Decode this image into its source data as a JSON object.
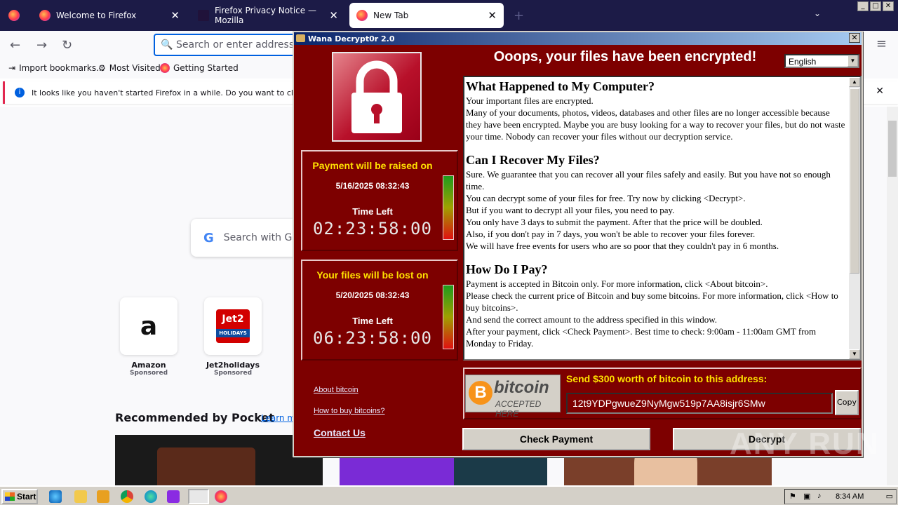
{
  "firefox": {
    "tabs": [
      {
        "label": "Welcome to Firefox"
      },
      {
        "label": "Firefox Privacy Notice — Mozilla"
      },
      {
        "label": "New Tab"
      }
    ],
    "urlbar_placeholder": "Search or enter address",
    "bookmarks": [
      "Import bookmarks...",
      "Most Visited",
      "Getting Started"
    ],
    "notification": "It looks like you haven't started Firefox in a while. Do you want to clean it up",
    "google_search": "Search with G",
    "tiles": [
      {
        "name": "Amazon",
        "sponsored": "Sponsored"
      },
      {
        "name": "Jet2holidays",
        "sponsored": "Sponsored",
        "logo_text": "Jet2",
        "logo_sub": "HOLIDAYS"
      }
    ],
    "pocket_title": "Recommended by Pocket",
    "pocket_link": "Learn m"
  },
  "wana": {
    "title": "Wana Decrypt0r 2.0",
    "headline": "Ooops, your files have been encrypted!",
    "language": "English",
    "timer1": {
      "heading": "Payment will be raised on",
      "date": "5/16/2025 08:32:43",
      "label": "Time Left",
      "countdown": "02:23:58:00"
    },
    "timer2": {
      "heading": "Your files will be lost on",
      "date": "5/20/2025 08:32:43",
      "label": "Time Left",
      "countdown": "06:23:58:00"
    },
    "sections": [
      {
        "heading": "What Happened to My Computer?",
        "lines": [
          "Your important files are encrypted.",
          "Many of your documents, photos, videos, databases and other files are no longer accessible because they have been encrypted. Maybe you are busy looking for a way to recover your files, but do not waste your time. Nobody can recover your files without our decryption service."
        ]
      },
      {
        "heading": "Can I Recover My Files?",
        "lines": [
          "Sure. We guarantee that you can recover all your files safely and easily. But you have not so enough time.",
          "You can decrypt some of your files for free. Try now by clicking <Decrypt>.",
          "But if you want to decrypt all your files, you need to pay.",
          "You only have 3 days to submit the payment. After that the price will be doubled.",
          "Also, if you don't pay in 7 days, you won't be able to recover your files forever.",
          "We will have free events for users who are so poor that they couldn't pay in 6 months."
        ]
      },
      {
        "heading": "How Do I Pay?",
        "lines": [
          "Payment is accepted in Bitcoin only. For more information, click <About bitcoin>.",
          "Please check the current price of Bitcoin and buy some bitcoins. For more information, click <How to buy bitcoins>.",
          "And send the correct amount to the address specified in this window.",
          "After your payment, click <Check Payment>. Best time to check: 9:00am - 11:00am GMT from Monday to Friday."
        ]
      }
    ],
    "links": [
      "About bitcoin",
      "How to buy bitcoins?",
      "Contact Us"
    ],
    "bitcoin_word": "bitcoin",
    "bitcoin_accepted": "ACCEPTED HERE",
    "bitcoin_symbol": "B",
    "send_label": "Send $300 worth of bitcoin to this address:",
    "address": "12t9YDPgwueZ9NyMgw519p7AA8isjr6SMw",
    "copy": "Copy",
    "check_payment": "Check Payment",
    "decrypt": "Decrypt"
  },
  "taskbar": {
    "start": "Start",
    "time": "8:34 AM"
  },
  "watermark": "ANY RUN"
}
